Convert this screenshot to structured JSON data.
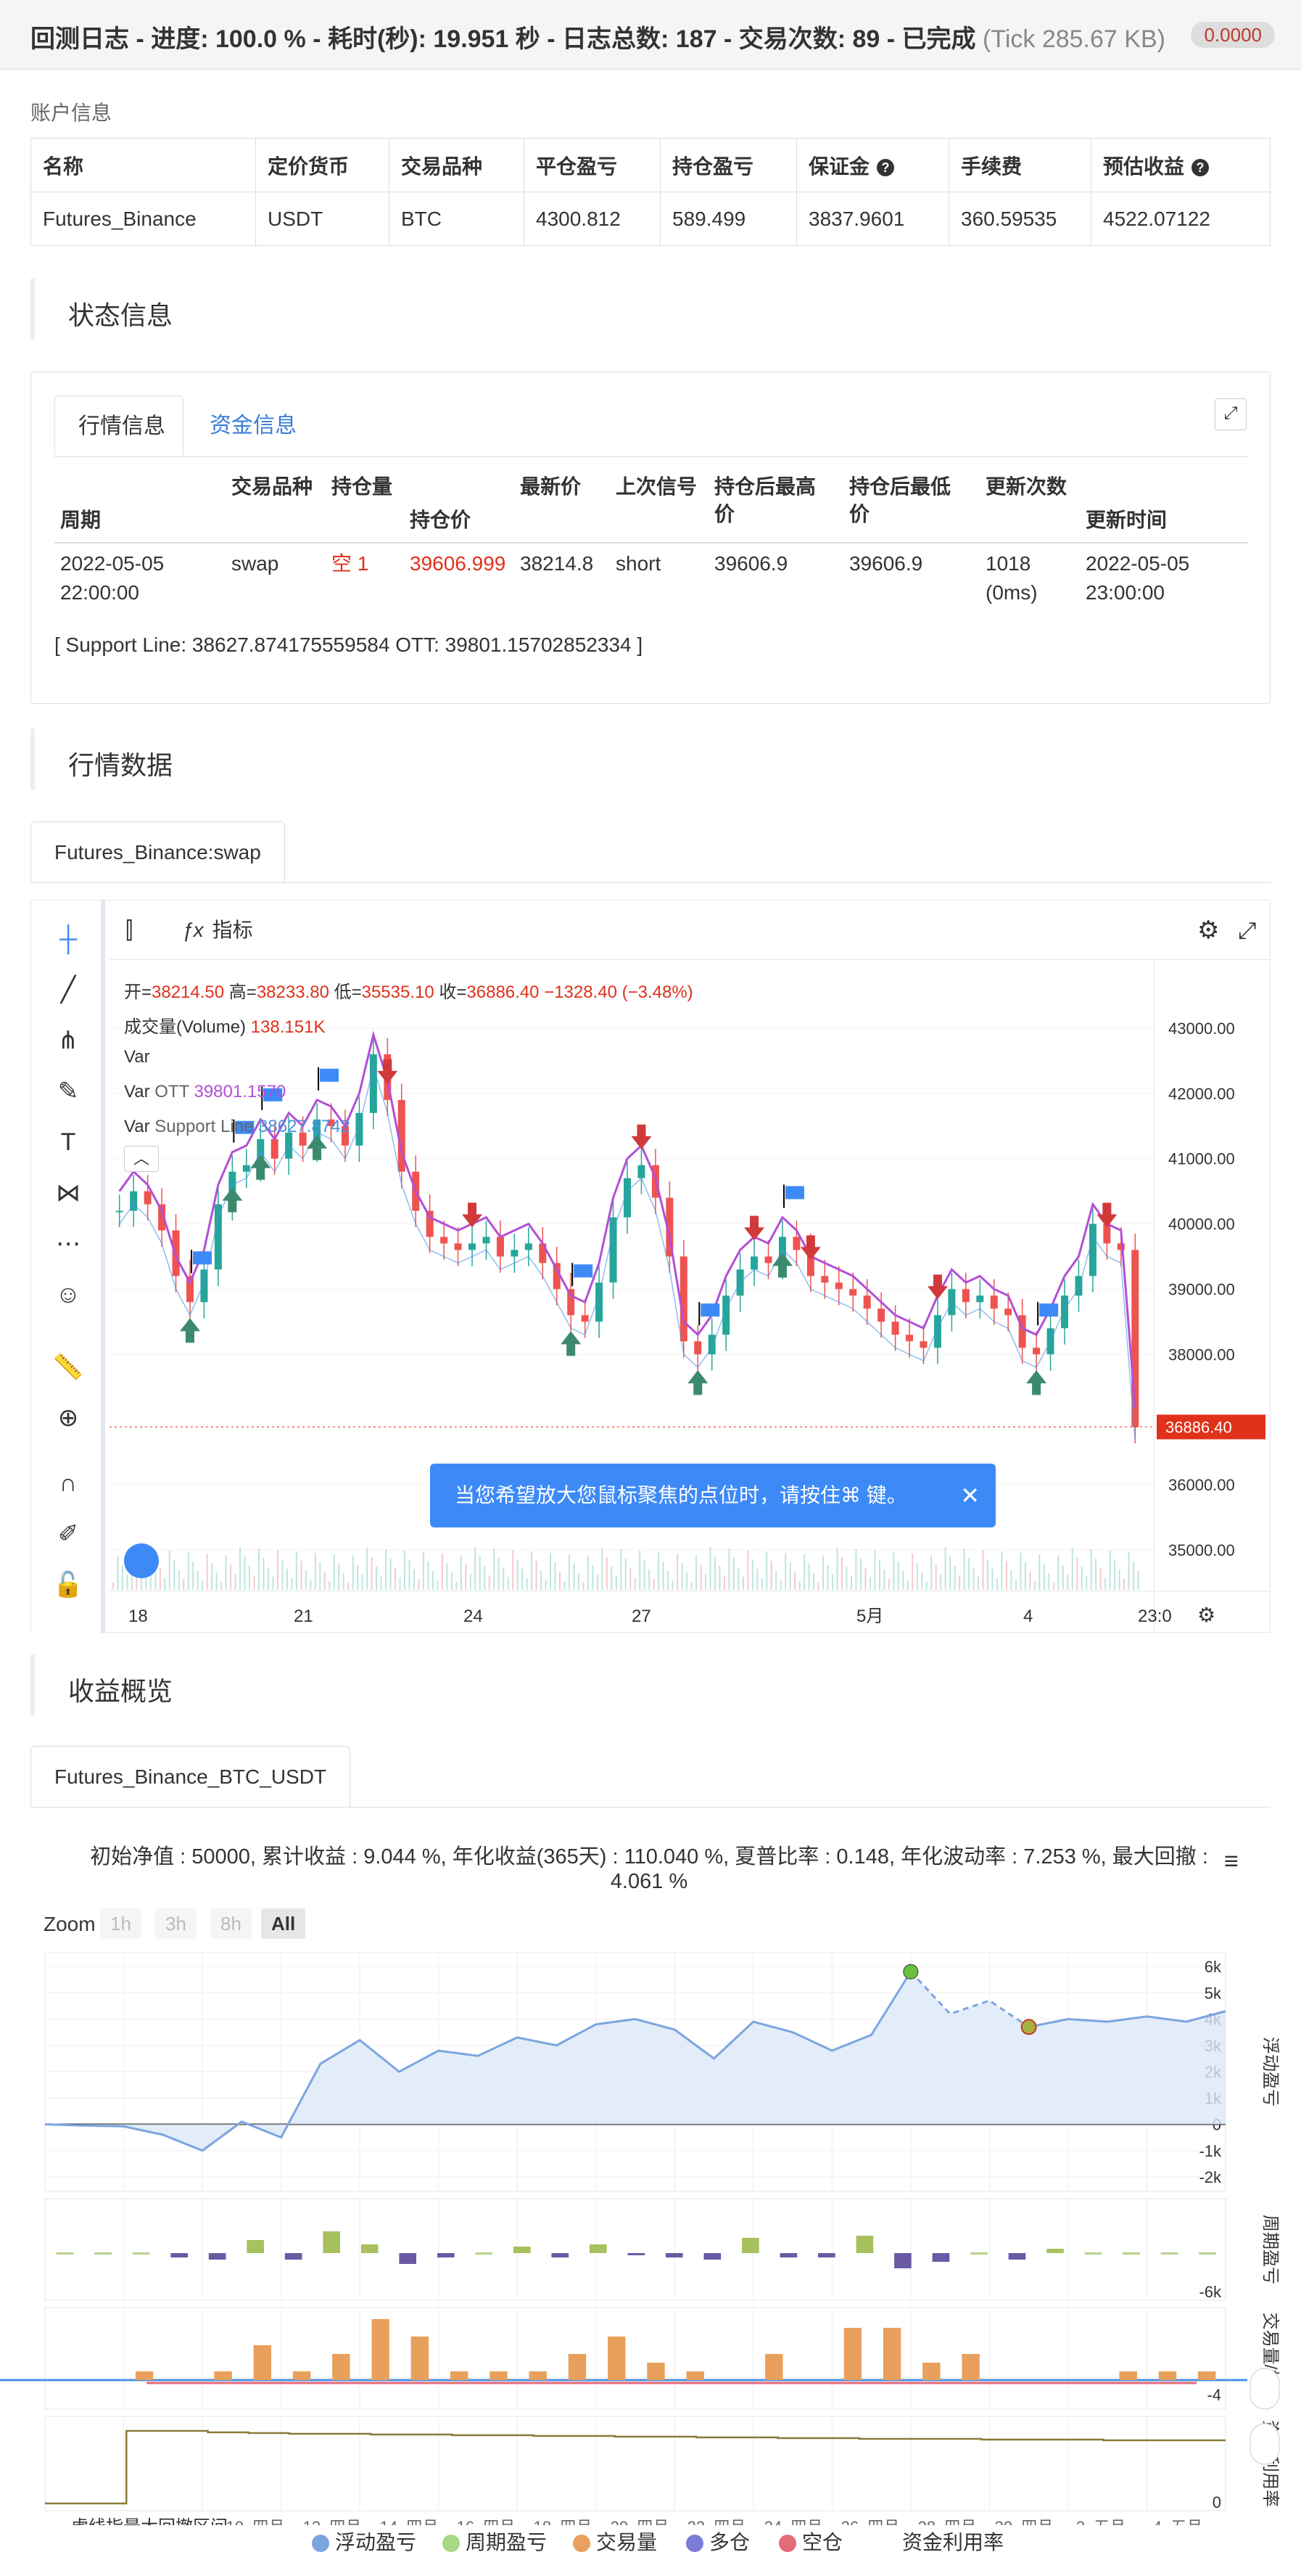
{
  "header": {
    "title": "回测日志 - 进度: 100.0 % - 耗时(秒): 19.951 秒 - 日志总数: 187 - 交易次数: 89 - 已完成",
    "tick": "(Tick 285.67 KB)",
    "badge": "0.0000"
  },
  "account": {
    "label": "账户信息",
    "columns": [
      "名称",
      "定价货币",
      "交易品种",
      "平仓盈亏",
      "持仓盈亏",
      "保证金",
      "手续费",
      "预估收益"
    ],
    "row": [
      "Futures_Binance",
      "USDT",
      "BTC",
      "4300.812",
      "589.499",
      "3837.9601",
      "360.59535",
      "4522.07122"
    ]
  },
  "status_section": {
    "title": "状态信息"
  },
  "status_tabs": {
    "market": "行情信息",
    "funds": "资金信息"
  },
  "market_table": {
    "headers": {
      "period": "周期",
      "symbol": "交易品种",
      "position": "持仓量",
      "hold_price": "持仓价",
      "last_price": "最新价",
      "last_signal": "上次信号",
      "max_after_l1": "持仓后最高",
      "max_after_l2": "价",
      "min_after_l1": "持仓后最低",
      "min_after_l2": "价",
      "updates": "更新次数",
      "update_time": "更新时间"
    },
    "row": {
      "period_l1": "2022-05-05",
      "period_l2": "22:00:00",
      "symbol": "swap",
      "position": "空 1",
      "hold_price": "39606.999",
      "last_price": "38214.8",
      "last_signal": "short",
      "max_after": "39606.9",
      "min_after": "39606.9",
      "updates_l1": "1018",
      "updates_l2": "(0ms)",
      "update_time_l1": "2022-05-05",
      "update_time_l2": "23:00:00"
    },
    "support_text": "[ Support Line: 38627.874175559584 OTT: 39801.15702852334 ]"
  },
  "market_section": {
    "title": "行情数据",
    "tab": "Futures_Binance:swap"
  },
  "tv": {
    "indicator_btn": "指标",
    "ohlc": {
      "open_label": "开=",
      "open": "38214.50",
      "high_label": "高=",
      "high": "38233.80",
      "low_label": "低=",
      "low": "35535.10",
      "close_label": "收=",
      "close": "36886.40",
      "change": "−1328.40 (−3.48%)"
    },
    "volume_label": "成交量(Volume)",
    "volume_value": "138.151K",
    "var1": "Var",
    "var_ott_label": "Var",
    "var_ott_name": "OTT",
    "var_ott_value": "39801.1570",
    "var_sl_label": "Var",
    "var_sl_name": "Support Line",
    "var_sl_value": "38627.8742",
    "price_ticks": [
      "43000.00",
      "42000.00",
      "41000.00",
      "40000.00",
      "39000.00",
      "38000.00",
      "36000.00",
      "35000.00"
    ],
    "current_price": "36886.40",
    "date_ticks": [
      "18",
      "21",
      "24",
      "27",
      "5月",
      "4",
      "23:0"
    ],
    "tooltip": "当您希望放大您鼠标聚焦的点位时，请按住⌘ 键。",
    "colors": {
      "up": "#26a69a",
      "down": "#ef5350",
      "ott": "#b24fd6",
      "support": "#4a90e2"
    },
    "candles": [
      40200,
      40500,
      40300,
      39900,
      39200,
      38800,
      39300,
      40300,
      40800,
      40900,
      41300,
      41000,
      41400,
      41200,
      41600,
      41500,
      41200,
      41700,
      42600,
      41900,
      40800,
      40200,
      39800,
      39700,
      39600,
      39700,
      39800,
      39500,
      39600,
      39700,
      39400,
      39000,
      38600,
      38500,
      39100,
      40100,
      40700,
      40900,
      40400,
      39500,
      38200,
      38000,
      38300,
      38900,
      39300,
      39500,
      39400,
      39800,
      39600,
      39200,
      39100,
      39000,
      38900,
      38700,
      38500,
      38300,
      38200,
      38100,
      38600,
      39000,
      38800,
      38900,
      38700,
      38600,
      38100,
      38000,
      38400,
      38900,
      39200,
      40000,
      39700,
      39600,
      36886
    ]
  },
  "profit_section": {
    "title": "收益概览",
    "tab": "Futures_Binance_BTC_USDT"
  },
  "summary": {
    "line1": "初始净值 : 50000, 累计收益 : 9.044 %, 年化收益(365天) : 110.040 %, 夏普比率 : 0.148, 年化波动率 : 7.253 %, 最大回撤 :",
    "line2": "4.061 %",
    "menu_icon": "hamburger-icon"
  },
  "zoom": {
    "label": "Zoom",
    "options": [
      "1h",
      "3h",
      "8h",
      "All"
    ],
    "selected": "All"
  },
  "chart_data": [
    {
      "type": "area",
      "name": "浮动盈亏",
      "yticks": [
        "6k",
        "5k",
        "4k",
        "3k",
        "2k",
        "1k",
        "0",
        "-1k",
        "-2k"
      ],
      "ylim": [
        -2000,
        6000
      ],
      "values": [
        0,
        -50,
        -80,
        -400,
        -1000,
        100,
        -500,
        2300,
        3200,
        2000,
        2800,
        2600,
        3300,
        3000,
        3800,
        4000,
        3600,
        2500,
        3900,
        3500,
        2800,
        3400,
        5800,
        4200,
        4700,
        3700,
        4000,
        3900,
        4100,
        3900,
        4300
      ]
    },
    {
      "type": "bar",
      "name": "周期盈亏",
      "yticks": [
        "-6k"
      ],
      "values": [
        0,
        0,
        0,
        -200,
        -300,
        600,
        -300,
        1000,
        400,
        -500,
        -200,
        0,
        300,
        -200,
        400,
        -100,
        -200,
        -300,
        700,
        -200,
        -200,
        800,
        -700,
        -400,
        0,
        -300,
        200,
        0,
        0,
        0,
        0
      ]
    },
    {
      "type": "bar",
      "name": "交易量",
      "yticks": [
        "-4"
      ],
      "values": [
        0,
        0,
        1,
        0,
        1,
        4,
        1,
        3,
        7,
        5,
        1,
        1,
        1,
        3,
        5,
        2,
        1,
        0,
        3,
        0,
        6,
        6,
        2,
        3,
        0,
        0,
        0,
        1,
        1,
        1
      ]
    },
    {
      "type": "line",
      "name": "资金利用率",
      "yticks": [
        "0"
      ],
      "values": [
        0,
        0,
        1,
        1,
        0.98,
        0.97,
        0.96,
        0.96,
        0.95,
        0.95,
        0.94,
        0.94,
        0.93,
        0.93,
        0.92,
        0.92,
        0.91,
        0.91,
        0.9,
        0.9,
        0.89,
        0.89,
        0.89,
        0.88,
        0.88,
        0.88,
        0.87,
        0.87,
        0.87,
        0.87
      ]
    }
  ],
  "x_ticks": [
    "10. 四月",
    "12. 四月",
    "14. 四月",
    "16. 四月",
    "18. 四月",
    "20. 四月",
    "22. 四月",
    "24. 四月",
    "26. 四月",
    "28. 四月",
    "30. 四月",
    "2. 五月",
    "4. 五月"
  ],
  "x_prefix_text": "虚线指最大回撤区间",
  "legend": [
    "浮动盈亏",
    "周期盈亏",
    "交易量",
    "多仓",
    "空仓",
    "资金利用率"
  ],
  "right_axis_labels": [
    "浮动盈亏",
    "周期盈亏",
    "交易量/持仓",
    "资金利用率"
  ],
  "legend_colors": [
    "#7ca5e0",
    "#a8d883",
    "#e8a05c",
    "#7b7bd8",
    "#e36b7a",
    "#9a8a58"
  ]
}
